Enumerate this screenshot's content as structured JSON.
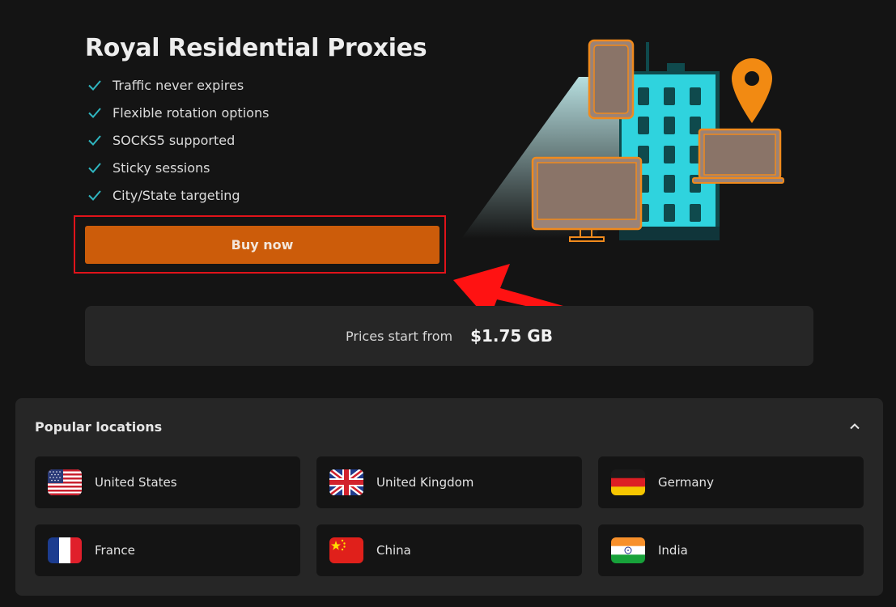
{
  "product": {
    "title": "Royal Residential Proxies",
    "features": [
      "Traffic never expires",
      "Flexible rotation options",
      "SOCKS5 supported",
      "Sticky sessions",
      "City/State targeting"
    ],
    "buy_label": "Buy now"
  },
  "pricing": {
    "label": "Prices start from",
    "value": "$1.75 GB"
  },
  "locations": {
    "title": "Popular locations",
    "items": [
      {
        "name": "United States",
        "flag": "us-flag-icon"
      },
      {
        "name": "United Kingdom",
        "flag": "uk-flag-icon"
      },
      {
        "name": "Germany",
        "flag": "germany-flag-icon"
      },
      {
        "name": "France",
        "flag": "france-flag-icon"
      },
      {
        "name": "China",
        "flag": "china-flag-icon"
      },
      {
        "name": "India",
        "flag": "india-flag-icon"
      }
    ]
  },
  "colors": {
    "background": "#141414",
    "panel": "#262626",
    "accent": "#cc5c0a",
    "check": "#2fb6c0",
    "annotation": "#e0131a"
  }
}
